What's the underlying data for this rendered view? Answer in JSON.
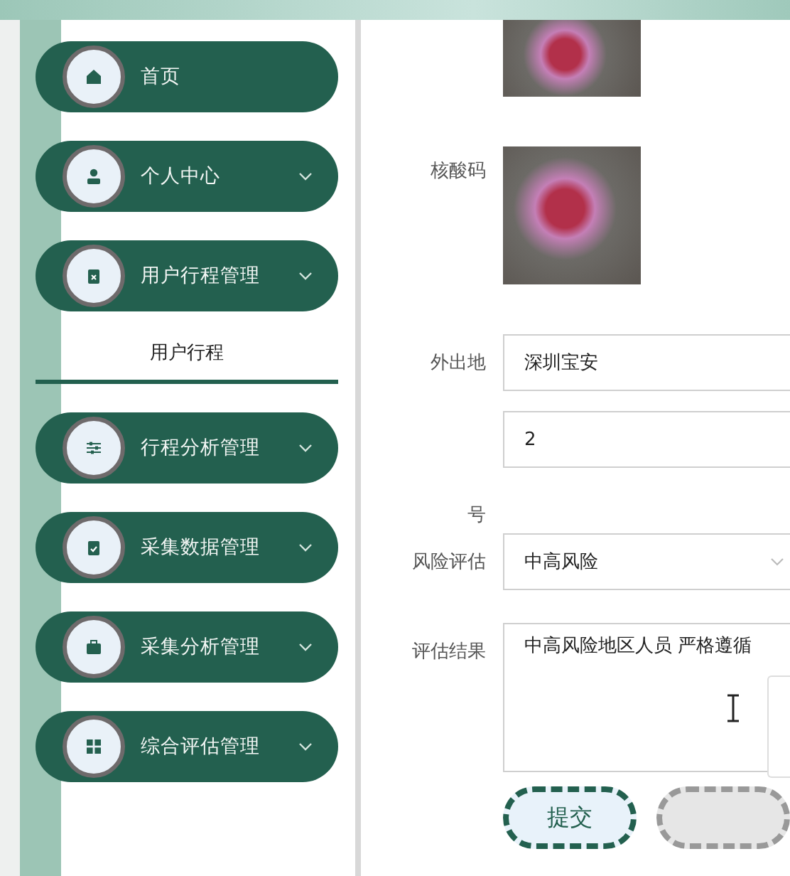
{
  "menu": [
    {
      "label": "首页",
      "kind": "link"
    },
    {
      "label": "个人中心",
      "kind": "group"
    },
    {
      "label": "用户行程管理",
      "kind": "group",
      "children": [
        {
          "label": "用户行程",
          "selected": true
        }
      ]
    },
    {
      "label": "行程分析管理",
      "kind": "group"
    },
    {
      "label": "采集数据管理",
      "kind": "group"
    },
    {
      "label": "采集分析管理",
      "kind": "group"
    },
    {
      "label": "综合评估管理",
      "kind": "group"
    }
  ],
  "form": [
    {
      "kind": "image",
      "cut": true
    },
    {
      "kind": "image",
      "label": "核酸码"
    },
    {
      "kind": "text",
      "label": "外出地",
      "value": "深圳宝安"
    },
    {
      "kind": "text",
      "label": "号",
      "value": "2"
    },
    {
      "kind": "select",
      "label": "风险评估",
      "value": "中高风险"
    },
    {
      "kind": "textarea",
      "label": "评估结果",
      "value": "中高风险地区人员 严格遵循"
    }
  ],
  "buttons": [
    {
      "kind": "primary",
      "label": "提交"
    },
    {
      "kind": "secondary"
    }
  ]
}
